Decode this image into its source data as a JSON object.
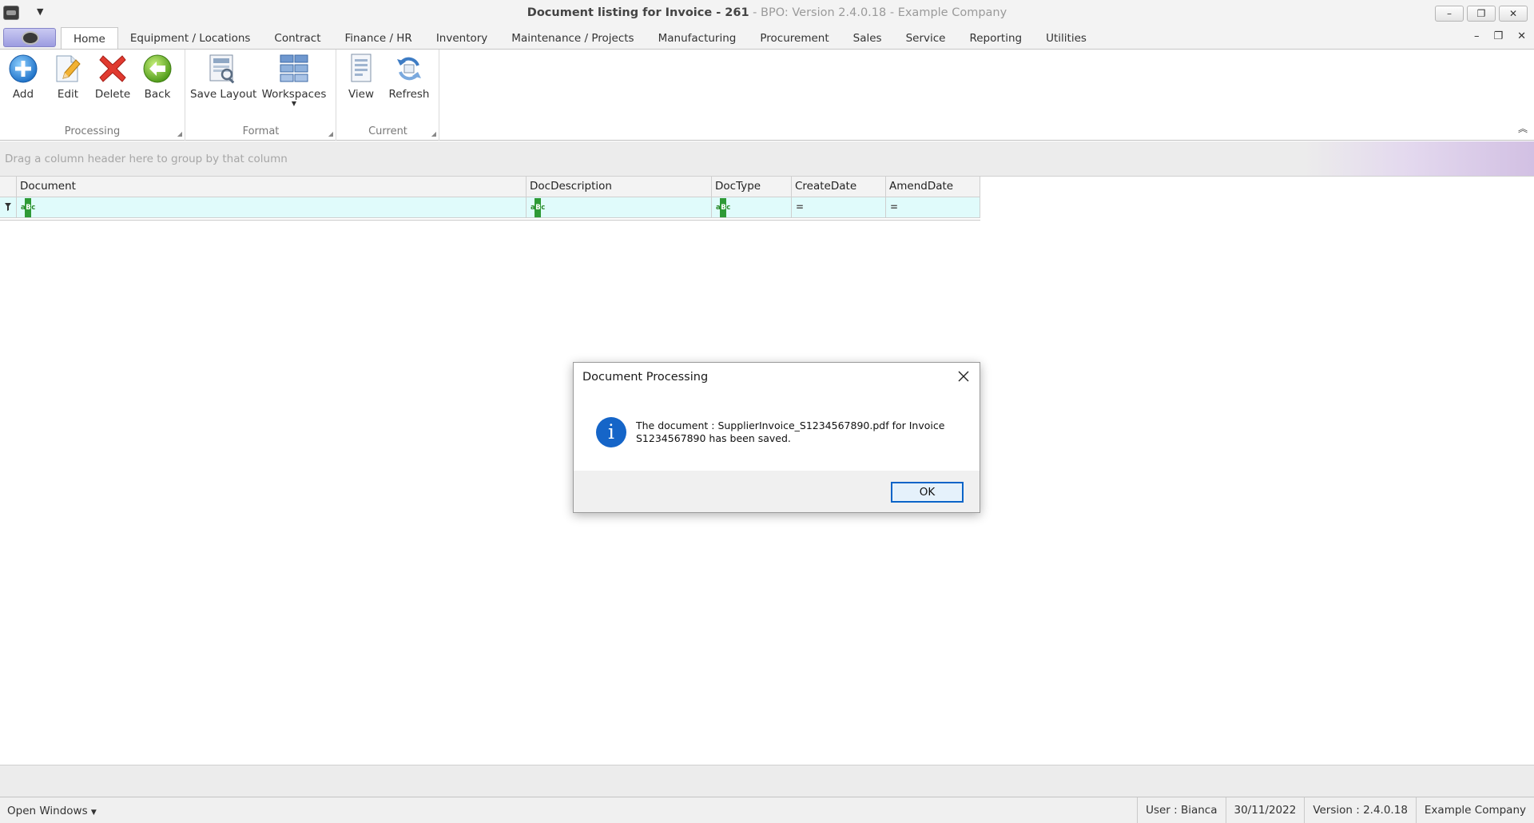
{
  "window": {
    "title_bold": "Document listing for Invoice - 261",
    "title_rest": " - BPO: Version 2.4.0.18 - Example Company",
    "minimize": "–",
    "restore": "❐",
    "close": "✕"
  },
  "qat": {
    "customize": "▼"
  },
  "ribbon": {
    "tabs": [
      "Home",
      "Equipment / Locations",
      "Contract",
      "Finance / HR",
      "Inventory",
      "Maintenance / Projects",
      "Manufacturing",
      "Procurement",
      "Sales",
      "Service",
      "Reporting",
      "Utilities"
    ],
    "active_tab": "Home",
    "groups": {
      "processing": {
        "label": "Processing",
        "buttons": {
          "add": "Add",
          "edit": "Edit",
          "delete": "Delete",
          "back": "Back"
        }
      },
      "format": {
        "label": "Format",
        "buttons": {
          "save_layout": "Save Layout",
          "workspaces": "Workspaces"
        }
      },
      "current": {
        "label": "Current",
        "buttons": {
          "view": "View",
          "refresh": "Refresh"
        }
      }
    },
    "mdi": {
      "minimize": "–",
      "restore": "❐",
      "close": "✕"
    },
    "collapse": "︽"
  },
  "grid": {
    "group_panel_hint": "Drag a column header here to group by that column",
    "columns": [
      {
        "name": "Document",
        "filter": "text"
      },
      {
        "name": "DocDescription",
        "filter": "text"
      },
      {
        "name": "DocType",
        "filter": "text"
      },
      {
        "name": "CreateDate",
        "filter": "equals"
      },
      {
        "name": "AmendDate",
        "filter": "equals"
      }
    ],
    "filter_row_icon": "funnel-icon"
  },
  "dialog": {
    "title": "Document Processing",
    "message": "The document : SupplierInvoice_S1234567890.pdf for Invoice S1234567890 has been saved.",
    "ok": "OK",
    "icon": "info-icon",
    "icon_glyph": "i"
  },
  "status": {
    "open_windows": "Open Windows",
    "user": "User : Bianca",
    "date": "30/11/2022",
    "version": "Version : 2.4.0.18",
    "company": "Example Company"
  },
  "colors": {
    "accent": "#1565c8",
    "filter_row": "#e0fbfb",
    "app_button": "#9c9ce0"
  }
}
